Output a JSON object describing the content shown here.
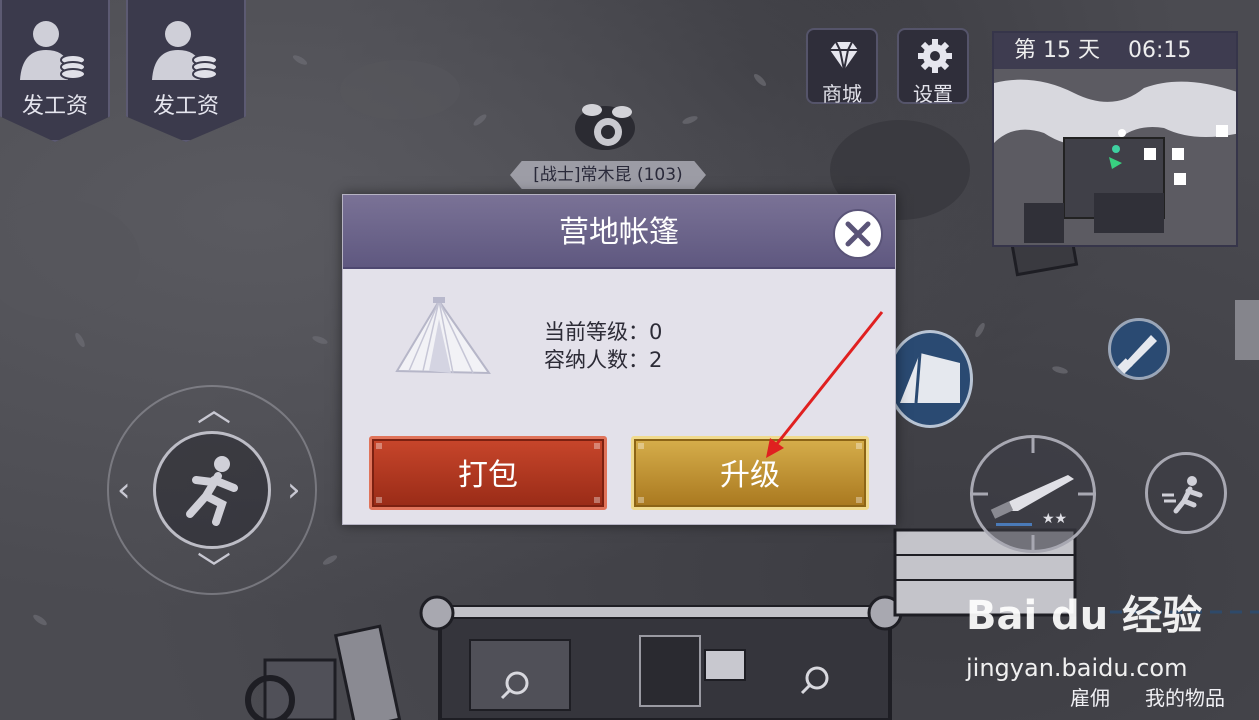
{
  "hud": {
    "pay_buttons": [
      {
        "label": "发工资"
      },
      {
        "label": "发工资"
      }
    ],
    "shop_label": "商城",
    "settings_label": "设置",
    "day_text": "第 15 天",
    "time_text": "06:15"
  },
  "player": {
    "name_tag": "[战士]常木昆 (103)"
  },
  "dialog": {
    "title": "营地帐篷",
    "level_line": "当前等级：0",
    "capacity_line": "容纳人数：2",
    "pack_label": "打包",
    "upgrade_label": "升级"
  },
  "bottom_bar": {
    "hire_label": "雇佣",
    "items_label": "我的物品"
  },
  "watermark": {
    "logo": "Bai du 经验",
    "url": "jingyan.baidu.com"
  },
  "colors": {
    "dialog_header": "#6b6489",
    "pack_button": "#b23a22",
    "upgrade_button": "#c79a3a",
    "annotation_arrow": "#e02020"
  }
}
